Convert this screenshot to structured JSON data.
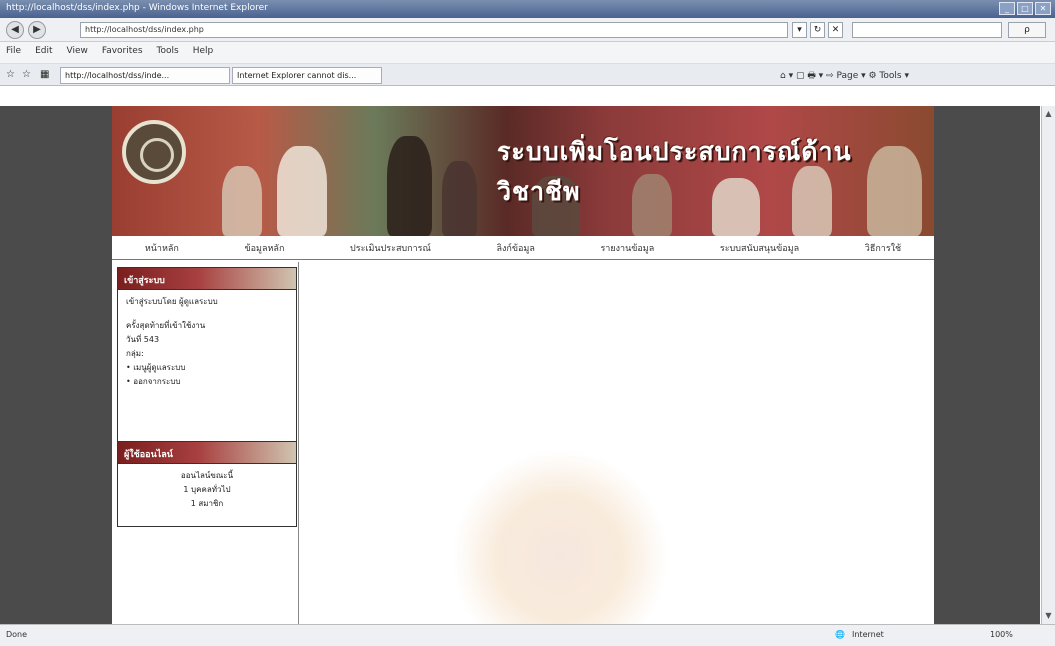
{
  "window": {
    "title": "http://localhost/dss/index.php - Windows Internet Explorer",
    "controls": [
      "_",
      "□",
      "✕"
    ]
  },
  "address_bar": {
    "url": "http://localhost/dss/index.php",
    "search_placeholder": "",
    "search_btn": "ρ"
  },
  "menu": {
    "items": [
      "File",
      "Edit",
      "View",
      "Favorites",
      "Tools",
      "Help"
    ]
  },
  "tabs": [
    {
      "label": "http://localhost/dss/inde..."
    },
    {
      "label": "Internet Explorer cannot dis..."
    }
  ],
  "toolbar_right": {
    "label": "⌂ ▾ ▢  🖶 ▾ ⇨ Page ▾ ⚙ Tools ▾"
  },
  "site": {
    "banner_title": "ระบบเพิ่มโอนประสบการณ์ด้านวิชาชีพ",
    "nav": [
      "หน้าหลัก",
      "ข้อมูลหลัก",
      "ประเมินประสบการณ์",
      "ลิงก์ข้อมูล",
      "รายงานข้อมูล",
      "ระบบสนับสนุนข้อมูล",
      "วิธีการใช้"
    ]
  },
  "login_box": {
    "header": "เข้าสู่ระบบ",
    "user_line": "เข้าสู่ระบบโดย ผู้ดูแลระบบ",
    "today_line": "ครั้งสุดท้ายที่เข้าใช้งาน",
    "date_line": "วันที่ 543",
    "group_line": "กลุ่ม:",
    "link1": "• เมนูผู้ดูแลระบบ",
    "link2": "• ออกจากระบบ"
  },
  "online_box": {
    "header": "ผู้ใช้ออนไลน์",
    "line1": "ออนไลน์ขณะนี้",
    "line2": "1 บุคคลทั่วไป",
    "line3": "1 สมาชิก"
  },
  "status": {
    "left": "Done",
    "zone": "Internet",
    "zoom": "100%"
  }
}
